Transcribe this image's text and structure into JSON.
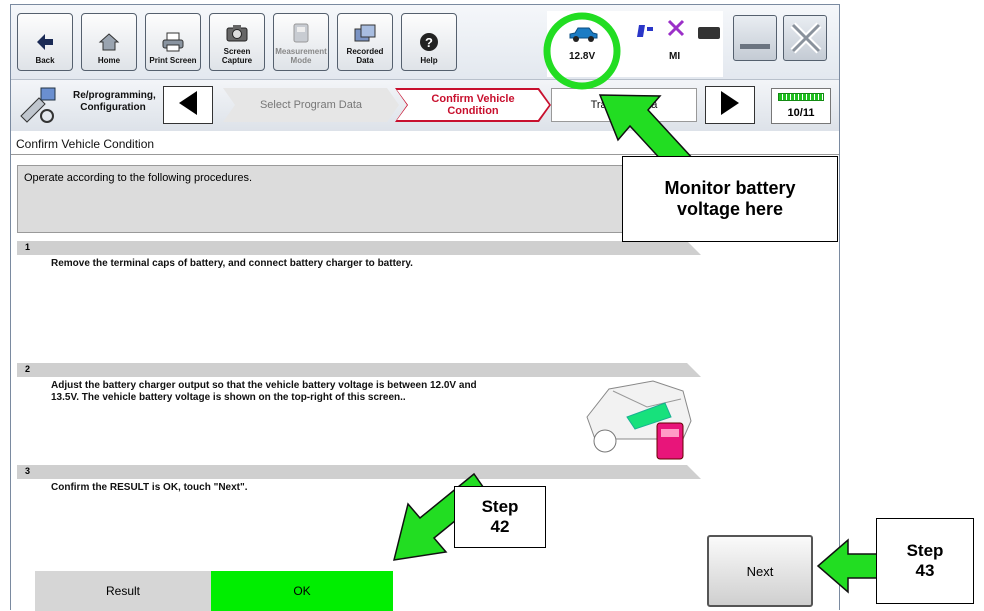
{
  "toolbar": {
    "buttons": [
      {
        "label": "Back",
        "icon": "back-arrow-icon"
      },
      {
        "label": "Home",
        "icon": "home-icon"
      },
      {
        "label": "Print Screen",
        "icon": "printer-icon"
      },
      {
        "label": "Screen\nCapture",
        "icon": "camera-icon"
      },
      {
        "label": "Measurement\nMode",
        "icon": "measurement-icon"
      },
      {
        "label": "Recorded\nData",
        "icon": "recorded-data-icon"
      },
      {
        "label": "Help",
        "icon": "help-icon"
      }
    ]
  },
  "status": {
    "battery_voltage": "12.8V",
    "mi_label": "MI"
  },
  "breadcrumb": {
    "title": "Re/programming,\nConfiguration",
    "steps": [
      "Select Program Data",
      "Confirm Vehicle\nCondition",
      "Transfer Data"
    ],
    "page": "10/11"
  },
  "panel": {
    "title": "Confirm Vehicle Condition",
    "instruction": "Operate according to the following procedures.",
    "steps": [
      {
        "num": "1",
        "text": "Remove the terminal caps of battery, and connect battery charger to battery."
      },
      {
        "num": "2",
        "text": "Adjust the battery charger output so that the vehicle battery voltage is between 12.0V and\n13.5V. The vehicle battery voltage is shown on the top-right of this screen.."
      },
      {
        "num": "3",
        "text": "Confirm the RESULT is OK, touch \"Next\"."
      }
    ],
    "result_label": "Result",
    "result_value": "OK",
    "next_label": "Next"
  },
  "callouts": {
    "monitor": "Monitor battery\nvoltage here",
    "step42": "Step\n42",
    "step43": "Step\n43"
  },
  "colors": {
    "callout_green": "#22dd22",
    "ok_green": "#00ee00",
    "active_tab": "#c8102e"
  }
}
